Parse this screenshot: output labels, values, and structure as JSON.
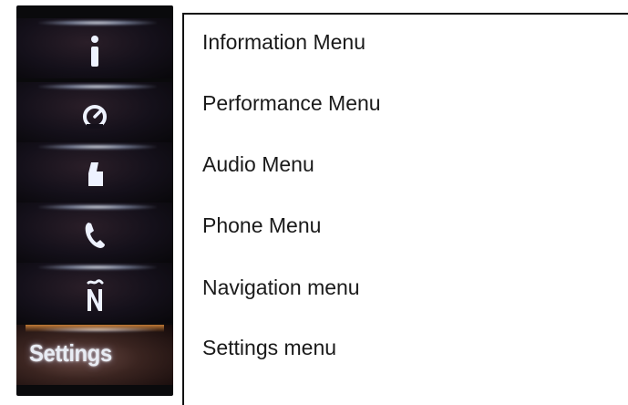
{
  "sidebar": {
    "items": [
      {
        "icon": "info-icon"
      },
      {
        "icon": "gauge-icon"
      },
      {
        "icon": "audio-icon"
      },
      {
        "icon": "phone-icon"
      },
      {
        "icon": "navigation-icon"
      },
      {
        "label": "Settings"
      }
    ]
  },
  "menu_list": {
    "items": [
      "Information Menu",
      "Performance Menu",
      "Audio Menu",
      "Phone Menu",
      "Navigation menu",
      "Settings menu"
    ]
  }
}
